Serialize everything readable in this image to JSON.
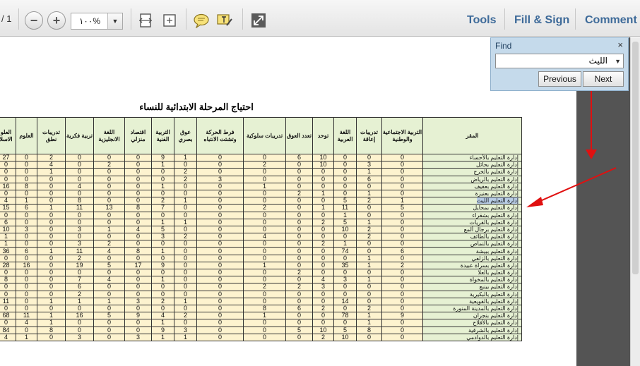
{
  "toolbar": {
    "page_of": "/ 1",
    "zoom_value": "١٠٠%",
    "links": {
      "tools": "Tools",
      "fill_sign": "Fill & Sign",
      "comment": "Comment"
    }
  },
  "find": {
    "title": "Find",
    "close": "×",
    "query": "الليث",
    "previous": "Previous",
    "next": "Next"
  },
  "document": {
    "title": "احتياج المرحلة الابتدائية للنساء",
    "headers": [
      "العلو الاسلا",
      "العلوم",
      "تدريبات نطق",
      "تربية فكرية",
      "اللغة الانجليزية",
      "اقتصاد منزلي",
      "التربية الفنية",
      "عوق بصري",
      "فرط الحركة وتشتت الانتباه",
      "تدريبات سلوكية",
      "تعدد العوق",
      "توحد",
      "اللغة العربية",
      "تدريبات إعاقة",
      "التربية الاجتماعية والوطنية",
      "المقر"
    ],
    "rows": [
      {
        "name": "إدارة التعليم بالأحساء",
        "v": [
          "27",
          "0",
          "2",
          "0",
          "0",
          "0",
          "9",
          "1",
          "0",
          "0",
          "6",
          "10",
          "0",
          "0",
          "0"
        ]
      },
      {
        "name": "إدارة التعليم بحائل",
        "v": [
          "0",
          "0",
          "4",
          "0",
          "2",
          "0",
          "1",
          "0",
          "0",
          "2",
          "0",
          "10",
          "0",
          "3",
          "0"
        ]
      },
      {
        "name": "إدارة التعليم بالخرج",
        "v": [
          "0",
          "0",
          "1",
          "0",
          "0",
          "0",
          "0",
          "2",
          "0",
          "0",
          "0",
          "0",
          "0",
          "1",
          "0"
        ]
      },
      {
        "name": "إدارة التعليم بالرياض",
        "v": [
          "0",
          "0",
          "0",
          "0",
          "0",
          "0",
          "0",
          "2",
          "3",
          "0",
          "0",
          "0",
          "0",
          "6",
          "0"
        ]
      },
      {
        "name": "إدارة التعليم بعفيف",
        "v": [
          "16",
          "8",
          "0",
          "4",
          "0",
          "0",
          "1",
          "0",
          "0",
          "1",
          "0",
          "0",
          "0",
          "0",
          "0"
        ]
      },
      {
        "name": "إدارة التعليم بعنيزة",
        "v": [
          "0",
          "0",
          "0",
          "0",
          "0",
          "0",
          "0",
          "0",
          "0",
          "0",
          "2",
          "1",
          "0",
          "1",
          "0"
        ]
      },
      {
        "name": "إدارة التعليم الليث",
        "v": [
          "4",
          "1",
          "0",
          "8",
          "0",
          "0",
          "2",
          "1",
          "0",
          "0",
          "0",
          "0",
          "5",
          "2",
          "1"
        ],
        "hl": true
      },
      {
        "name": "إدارة التعليم بمحايل",
        "v": [
          "15",
          "6",
          "1",
          "11",
          "13",
          "8",
          "7",
          "0",
          "0",
          "2",
          "0",
          "1",
          "11",
          "0",
          "5"
        ]
      },
      {
        "name": "إدارة التعليم بشقراء",
        "v": [
          "0",
          "0",
          "0",
          "0",
          "0",
          "0",
          "0",
          "0",
          "0",
          "0",
          "0",
          "0",
          "1",
          "0",
          "0"
        ]
      },
      {
        "name": "إدارة التعليم بالقريات",
        "v": [
          "6",
          "0",
          "0",
          "0",
          "0",
          "0",
          "1",
          "1",
          "0",
          "0",
          "0",
          "2",
          "5",
          "1",
          "0"
        ]
      },
      {
        "name": "إدارة التعليم برجال ألمع",
        "v": [
          "10",
          "3",
          "0",
          "3",
          "1",
          "4",
          "5",
          "0",
          "0",
          "0",
          "0",
          "0",
          "10",
          "2",
          "0"
        ]
      },
      {
        "name": "إدارة التعليم بالطائف",
        "v": [
          "1",
          "0",
          "0",
          "0",
          "0",
          "0",
          "3",
          "2",
          "0",
          "4",
          "0",
          "0",
          "0",
          "2",
          "0"
        ]
      },
      {
        "name": "إدارة التعليم بالنماص",
        "v": [
          "1",
          "0",
          "0",
          "3",
          "2",
          "0",
          "0",
          "0",
          "0",
          "0",
          "0",
          "2",
          "1",
          "0",
          "0"
        ]
      },
      {
        "name": "إدارة التعليم ببيشة",
        "v": [
          "36",
          "6",
          "1",
          "11",
          "4",
          "8",
          "1",
          "0",
          "0",
          "0",
          "0",
          "0",
          "74",
          "0",
          "6"
        ]
      },
      {
        "name": "إدارة التعليم بالزلفي",
        "v": [
          "0",
          "0",
          "0",
          "2",
          "0",
          "0",
          "0",
          "0",
          "0",
          "0",
          "0",
          "0",
          "0",
          "1",
          "0"
        ]
      },
      {
        "name": "إدارة التعليم بسراة عبيدة",
        "v": [
          "28",
          "16",
          "0",
          "19",
          "5",
          "17",
          "9",
          "0",
          "0",
          "1",
          "0",
          "0",
          "35",
          "1",
          "2"
        ]
      },
      {
        "name": "إدارة التعليم بالعلا",
        "v": [
          "0",
          "0",
          "0",
          "0",
          "0",
          "0",
          "0",
          "0",
          "0",
          "0",
          "2",
          "0",
          "0",
          "0",
          "0"
        ]
      },
      {
        "name": "إدارة التعليم بالمخواة",
        "v": [
          "8",
          "0",
          "0",
          "7",
          "4",
          "0",
          "1",
          "0",
          "0",
          "0",
          "0",
          "4",
          "3",
          "1",
          "0"
        ]
      },
      {
        "name": "إدارة التعليم بينبع",
        "v": [
          "0",
          "0",
          "0",
          "6",
          "0",
          "0",
          "0",
          "0",
          "0",
          "2",
          "2",
          "3",
          "0",
          "0",
          "0"
        ]
      },
      {
        "name": "إدارة التعليم بالبكيرية",
        "v": [
          "0",
          "0",
          "0",
          "2",
          "0",
          "0",
          "0",
          "0",
          "0",
          "0",
          "0",
          "0",
          "0",
          "0",
          "0"
        ]
      },
      {
        "name": "إدارة التعليم بالقويعية",
        "v": [
          "11",
          "0",
          "1",
          "1",
          "1",
          "3",
          "2",
          "1",
          "0",
          "0",
          "0",
          "0",
          "14",
          "0",
          "0"
        ]
      },
      {
        "name": "إدارة التعليم بالمدينة المنورة",
        "v": [
          "0",
          "0",
          "0",
          "0",
          "0",
          "0",
          "0",
          "0",
          "0",
          "8",
          "6",
          "2",
          "0",
          "2",
          "0"
        ]
      },
      {
        "name": "إدارة التعليم بنجران",
        "v": [
          "68",
          "11",
          "1",
          "16",
          "5",
          "9",
          "4",
          "2",
          "0",
          "1",
          "0",
          "0",
          "78",
          "1",
          "9"
        ]
      },
      {
        "name": "إدارة التعليم بالأفلاج",
        "v": [
          "0",
          "4",
          "1",
          "0",
          "0",
          "0",
          "1",
          "0",
          "0",
          "0",
          "0",
          "0",
          "0",
          "1",
          "0"
        ]
      },
      {
        "name": "إدارة التعليم بالشرقية",
        "v": [
          "84",
          "0",
          "8",
          "0",
          "0",
          "0",
          "9",
          "3",
          "0",
          "0",
          "5",
          "10",
          "5",
          "8",
          "0"
        ]
      },
      {
        "name": "إدارة التعليم بالدوادمي",
        "v": [
          "4",
          "1",
          "0",
          "3",
          "0",
          "3",
          "1",
          "1",
          "0",
          "0",
          "0",
          "2",
          "10",
          "0",
          "0"
        ]
      }
    ]
  }
}
